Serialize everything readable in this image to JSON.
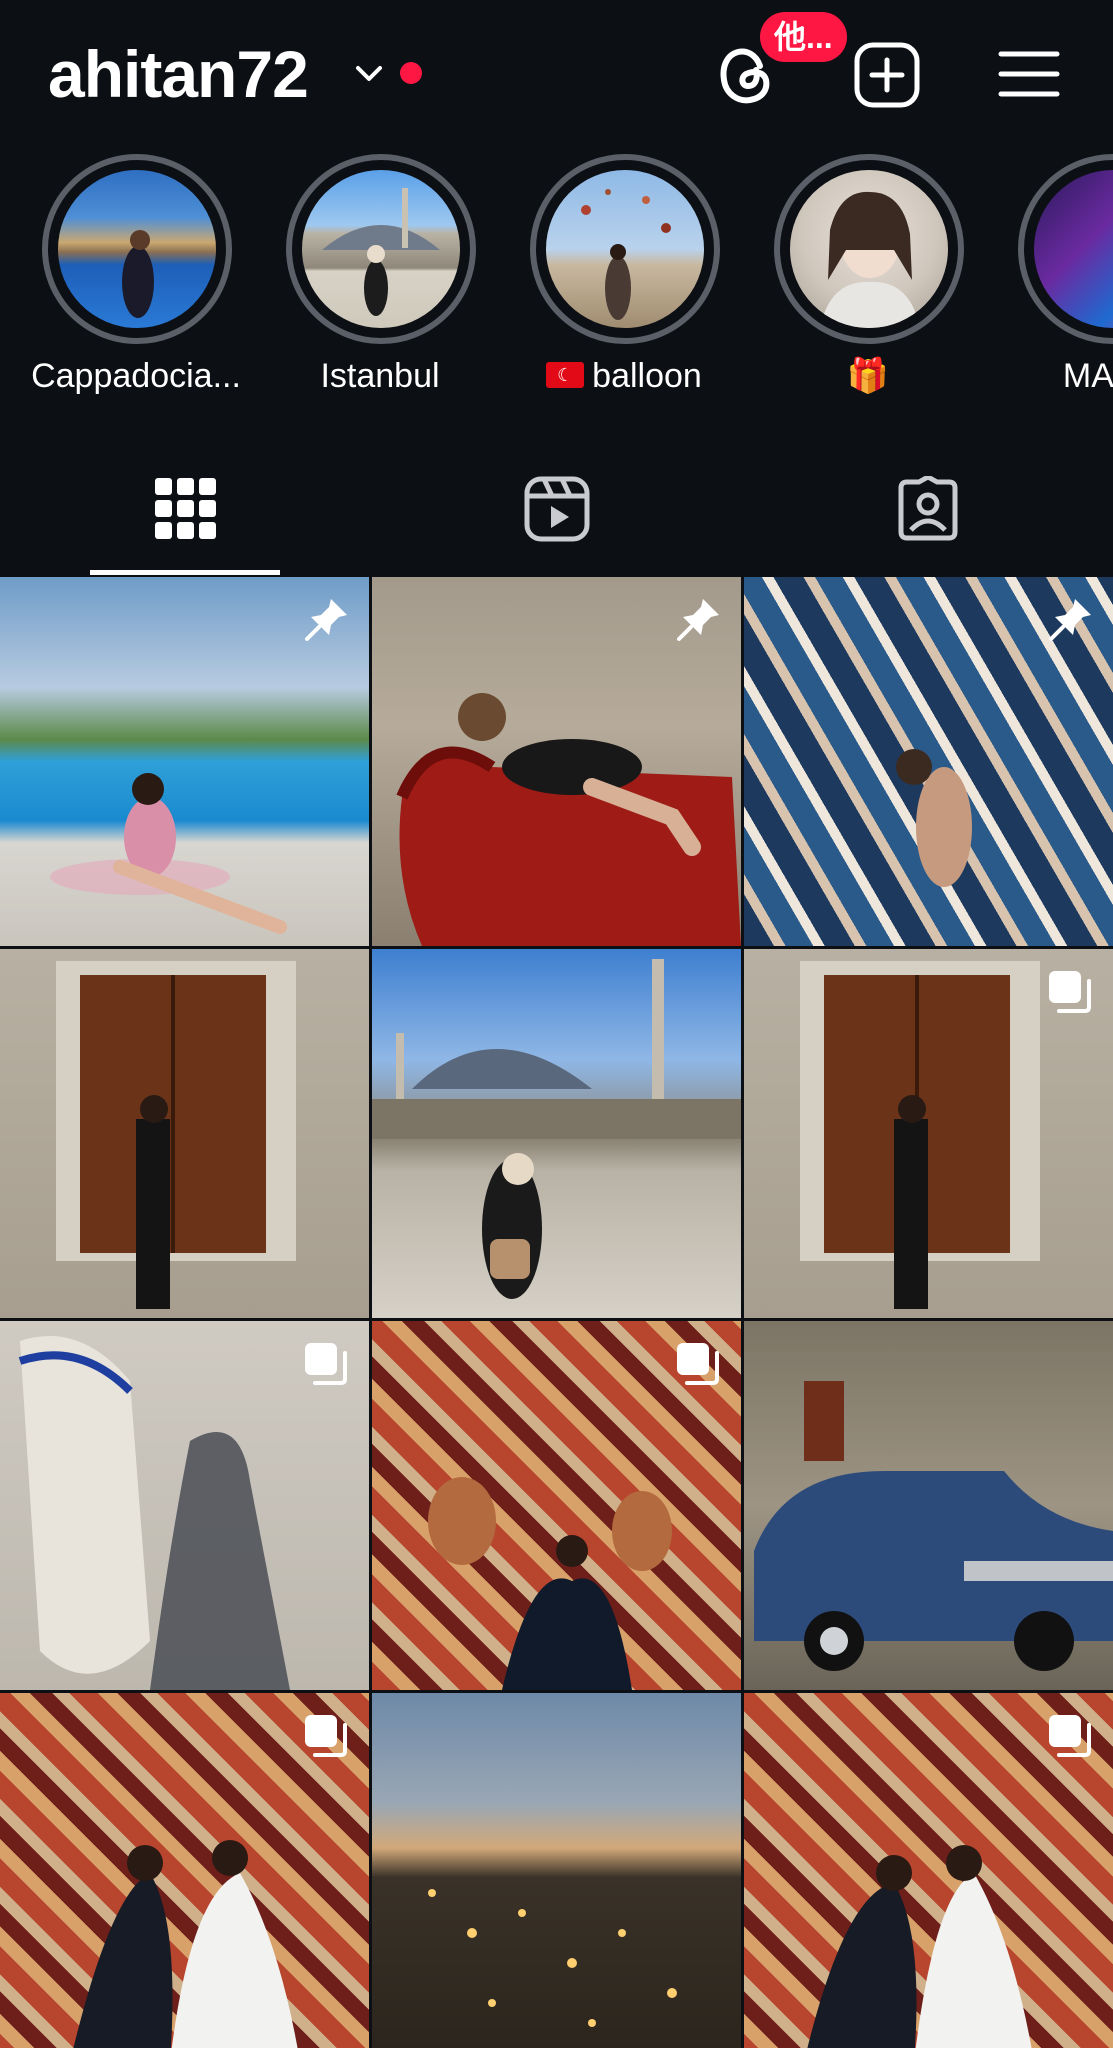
{
  "header": {
    "username": "ahitan72",
    "threads_badge": "他...",
    "icons": [
      "chevron-down-icon",
      "threads-icon",
      "create-post-icon",
      "menu-icon"
    ],
    "status_dot_color": "#ff1744"
  },
  "highlights": [
    {
      "label": "Cappadocia..."
    },
    {
      "label": "Istanbul"
    },
    {
      "label": "balloon",
      "flag": "turkey-flag"
    },
    {
      "label": "🎁"
    },
    {
      "label": "MAHA"
    }
  ],
  "tabs": [
    {
      "name": "posts",
      "icon": "grid-icon",
      "active": true
    },
    {
      "name": "reels",
      "icon": "reels-icon",
      "active": false
    },
    {
      "name": "tagged",
      "icon": "tagged-icon",
      "active": false
    }
  ],
  "posts": [
    {
      "overlay": "pin"
    },
    {
      "overlay": "pin"
    },
    {
      "overlay": "pin"
    },
    {
      "overlay": "none"
    },
    {
      "overlay": "none"
    },
    {
      "overlay": "carousel"
    },
    {
      "overlay": "carousel"
    },
    {
      "overlay": "carousel"
    },
    {
      "overlay": "none"
    },
    {
      "overlay": "carousel"
    },
    {
      "overlay": "none"
    },
    {
      "overlay": "carousel"
    }
  ],
  "colors": {
    "background": "#0c0f14",
    "ring": "#5b5f68",
    "accent_red": "#ff1744"
  }
}
